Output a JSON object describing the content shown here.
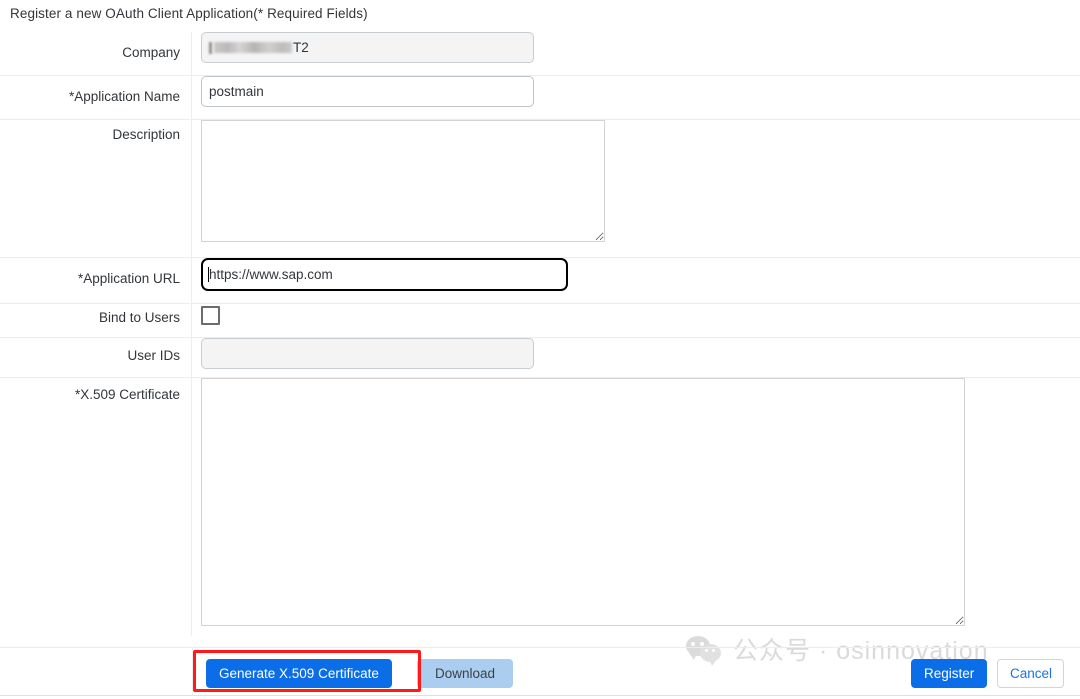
{
  "page": {
    "title": "Register a new OAuth Client Application(* Required Fields)"
  },
  "form": {
    "fields": [
      {
        "label": "Company",
        "value_suffix": "T2",
        "redacted": true,
        "disabled": true,
        "type": "text"
      },
      {
        "label": "*Application Name",
        "value": "postmain",
        "type": "text"
      },
      {
        "label": "Description",
        "value": "",
        "type": "textarea"
      },
      {
        "label": "*Application URL",
        "value": "https://www.sap.com",
        "type": "text",
        "focused": true
      },
      {
        "label": "Bind to Users",
        "checked": false,
        "type": "checkbox"
      },
      {
        "label": "User IDs",
        "value": "",
        "disabled": true,
        "type": "text"
      },
      {
        "label": "*X.509 Certificate",
        "value": "",
        "type": "textarea"
      }
    ]
  },
  "footer": {
    "generate_label": "Generate X.509 Certificate",
    "download_label": "Download",
    "register_label": "Register",
    "cancel_label": "Cancel"
  },
  "watermark": {
    "text": "公众号 · osinnovation",
    "logo": "wechat-icon"
  },
  "colors": {
    "primary_blue": "#0b6ee8",
    "light_blue": "#aacdf0",
    "link_blue": "#1a73e8",
    "highlight_red": "#ff1a1a",
    "divider": "#ededed",
    "text": "#32363a"
  }
}
